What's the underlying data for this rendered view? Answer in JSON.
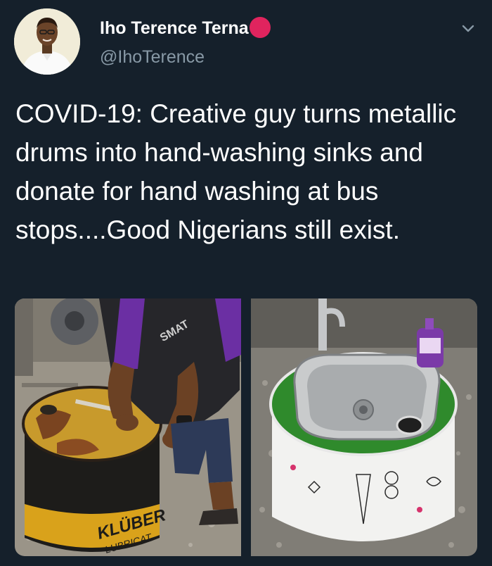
{
  "tweet": {
    "author_name": "Iho Terence Terna",
    "author_handle": "@IhoTerence",
    "text": "COVID-19: Creative guy turns metallic drums into hand-washing sinks and donate for hand washing at bus stops....Good Nigerians still exist."
  },
  "icons": {
    "badge": "red-circle-emoji",
    "menu": "chevron-down-icon"
  },
  "media": {
    "left_drum_label": "KLÜBER",
    "left_drum_sublabel": "LUBRICAT",
    "shirt_print": "SMAT"
  },
  "colors": {
    "background": "#15202b",
    "secondary_text": "#8899a6",
    "badge": "#e0245e"
  }
}
